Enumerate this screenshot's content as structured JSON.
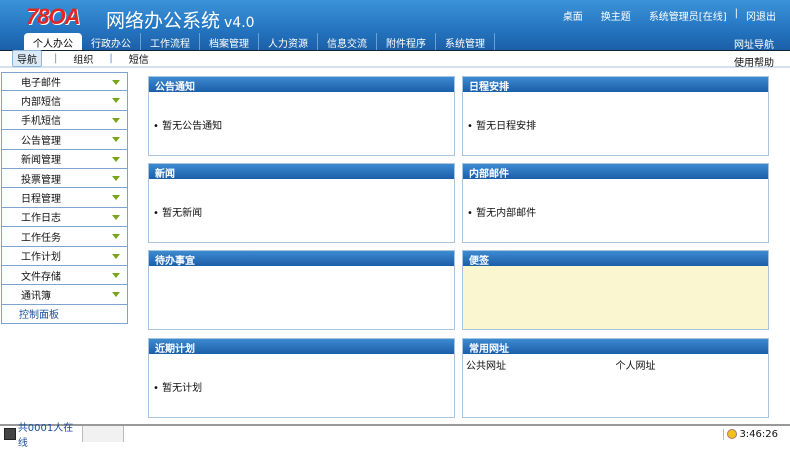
{
  "header": {
    "logo": "78OA",
    "title": "网络办公系统",
    "version": "v4.0",
    "links": [
      "桌面",
      "换主题",
      "系统管理员[在线]",
      "|",
      "冈退出"
    ],
    "tabs": [
      "个人办公",
      "行政办公",
      "工作流程",
      "档案管理",
      "人力资源",
      "信息交流",
      "附件程序",
      "系统管理"
    ],
    "nav_link": "网址导航"
  },
  "subnav": {
    "items": [
      "导航",
      "组织",
      "短信"
    ],
    "help": "使用帮助"
  },
  "sidebar": {
    "items": [
      "电子邮件",
      "内部短信",
      "手机短信",
      "公告管理",
      "新闻管理",
      "投票管理",
      "日程管理",
      "工作日志",
      "工作任务",
      "工作计划",
      "文件存储",
      "通讯簿"
    ],
    "control": "控制面板"
  },
  "panels": {
    "notice": {
      "title": "公告通知",
      "text": "• 暂无公告通知"
    },
    "schedule": {
      "title": "日程安排",
      "text": "• 暂无日程安排"
    },
    "news": {
      "title": "新闻",
      "text": "• 暂无新闻"
    },
    "mail": {
      "title": "内部邮件",
      "text": "• 暂无内部邮件"
    },
    "todo": {
      "title": "待办事宜"
    },
    "memo": {
      "title": "便签"
    },
    "plan": {
      "title": "近期计划",
      "text": "• 暂无计划"
    },
    "links": {
      "title": "常用网址",
      "public": "公共网址",
      "personal": "个人网址"
    }
  },
  "status": {
    "online": "共0001人在线",
    "time": "3:46:26"
  }
}
